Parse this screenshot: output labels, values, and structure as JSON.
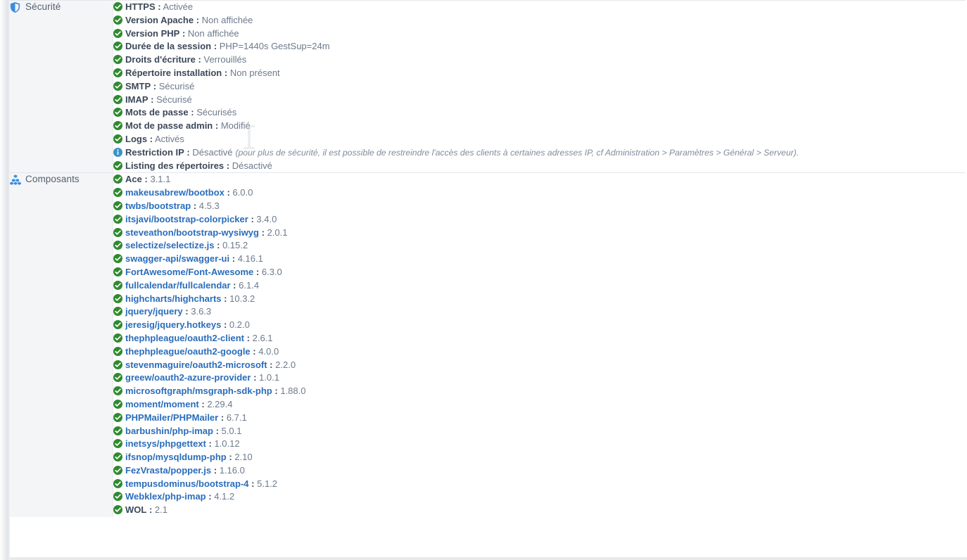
{
  "sections": [
    {
      "id": "securite",
      "label": "Sécurité",
      "icon": "shield-icon",
      "items": [
        {
          "status": "ok",
          "key": "HTTPS",
          "value": "Activée",
          "link": false
        },
        {
          "status": "ok",
          "key": "Version Apache",
          "value": "Non affichée",
          "link": false
        },
        {
          "status": "ok",
          "key": "Version PHP",
          "value": "Non affichée",
          "link": false
        },
        {
          "status": "ok",
          "key": "Durée de la session",
          "value": "PHP=1440s GestSup=24m",
          "link": false
        },
        {
          "status": "ok",
          "key": "Droits d'écriture",
          "value": "Verrouillés",
          "link": false
        },
        {
          "status": "ok",
          "key": "Répertoire installation",
          "value": "Non présent",
          "link": false
        },
        {
          "status": "ok",
          "key": "SMTP",
          "value": "Sécurisé",
          "link": false
        },
        {
          "status": "ok",
          "key": "IMAP",
          "value": "Sécurisé",
          "link": false
        },
        {
          "status": "ok",
          "key": "Mots de passe",
          "value": "Sécurisés",
          "link": false
        },
        {
          "status": "ok",
          "key": "Mot de passe admin",
          "value": "Modifié",
          "link": false
        },
        {
          "status": "ok",
          "key": "Logs",
          "value": "Activés",
          "link": false
        },
        {
          "status": "info",
          "key": "Restriction IP",
          "value": "Désactivé",
          "link": false,
          "note": "(pour plus de sécurité, il est possible de restreindre l'accès des clients à certaines adresses IP, cf Administration > Paramètres > Général > Serveur)."
        },
        {
          "status": "ok",
          "key": "Listing des répertoires",
          "value": "Désactivé",
          "link": false
        }
      ]
    },
    {
      "id": "composants",
      "label": "Composants",
      "icon": "cubes-icon",
      "items": [
        {
          "status": "ok",
          "key": "Ace",
          "value": "3.1.1",
          "link": false
        },
        {
          "status": "ok",
          "key": "makeusabrew/bootbox",
          "value": "6.0.0",
          "link": true
        },
        {
          "status": "ok",
          "key": "twbs/bootstrap",
          "value": "4.5.3",
          "link": true
        },
        {
          "status": "ok",
          "key": "itsjavi/bootstrap-colorpicker",
          "value": "3.4.0",
          "link": true
        },
        {
          "status": "ok",
          "key": "steveathon/bootstrap-wysiwyg",
          "value": "2.0.1",
          "link": true
        },
        {
          "status": "ok",
          "key": "selectize/selectize.js",
          "value": "0.15.2",
          "link": true
        },
        {
          "status": "ok",
          "key": "swagger-api/swagger-ui",
          "value": "4.16.1",
          "link": true
        },
        {
          "status": "ok",
          "key": "FortAwesome/Font-Awesome",
          "value": "6.3.0",
          "link": true
        },
        {
          "status": "ok",
          "key": "fullcalendar/fullcalendar",
          "value": "6.1.4",
          "link": true
        },
        {
          "status": "ok",
          "key": "highcharts/highcharts",
          "value": "10.3.2",
          "link": true
        },
        {
          "status": "ok",
          "key": "jquery/jquery",
          "value": "3.6.3",
          "link": true
        },
        {
          "status": "ok",
          "key": "jeresig/jquery.hotkeys",
          "value": "0.2.0",
          "link": true
        },
        {
          "status": "ok",
          "key": "thephpleague/oauth2-client",
          "value": "2.6.1",
          "link": true
        },
        {
          "status": "ok",
          "key": "thephpleague/oauth2-google",
          "value": "4.0.0",
          "link": true
        },
        {
          "status": "ok",
          "key": "stevenmaguire/oauth2-microsoft",
          "value": "2.2.0",
          "link": true
        },
        {
          "status": "ok",
          "key": "greew/oauth2-azure-provider",
          "value": "1.0.1",
          "link": true
        },
        {
          "status": "ok",
          "key": "microsoftgraph/msgraph-sdk-php",
          "value": "1.88.0",
          "link": true
        },
        {
          "status": "ok",
          "key": "moment/moment",
          "value": "2.29.4",
          "link": true
        },
        {
          "status": "ok",
          "key": "PHPMailer/PHPMailer",
          "value": "6.7.1",
          "link": true
        },
        {
          "status": "ok",
          "key": "barbushin/php-imap",
          "value": "5.0.1",
          "link": true
        },
        {
          "status": "ok",
          "key": "inetsys/phpgettext",
          "value": "1.0.12",
          "link": true
        },
        {
          "status": "ok",
          "key": "ifsnop/mysqldump-php",
          "value": "2.10",
          "link": true
        },
        {
          "status": "ok",
          "key": "FezVrasta/popper.js",
          "value": "1.16.0",
          "link": true
        },
        {
          "status": "ok",
          "key": "tempusdominus/bootstrap-4",
          "value": "5.1.2",
          "link": true
        },
        {
          "status": "ok",
          "key": "Webklex/php-imap",
          "value": "4.1.2",
          "link": true
        },
        {
          "status": "ok",
          "key": "WOL",
          "value": "2.1",
          "link": false
        }
      ]
    }
  ],
  "separator": ":",
  "colors": {
    "ok": "#2f8a2f",
    "info": "#3a94c4",
    "link": "#2a6dbb",
    "label_text": "#525f70",
    "value_text": "#6d7a8c",
    "sidebar_bg": "#f4f5f7",
    "border": "#e3e6ea"
  }
}
